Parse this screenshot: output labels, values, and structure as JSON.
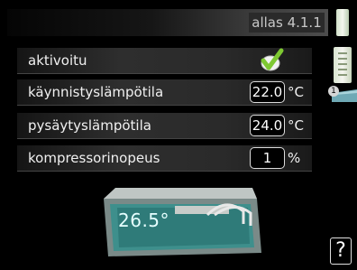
{
  "header": {
    "menu_id": "allas 4.1.1"
  },
  "rows": [
    {
      "label": "aktivoitu",
      "checked": true
    },
    {
      "label": "käynnistyslämpötila",
      "value": "22.0",
      "unit": "°C"
    },
    {
      "label": "pysäytyslämpötila",
      "value": "24.0",
      "unit": "°C"
    },
    {
      "label": "kompressorinopeus",
      "value": "1",
      "unit": "%"
    }
  ],
  "pool": {
    "temperature": "26.5°"
  },
  "side": {
    "page_badge": "1"
  },
  "help": {
    "label": "?"
  },
  "colors": {
    "checkmark": "#7ec832",
    "pool_water": "#3e8f8c",
    "scroll_green": "#d8e4cf"
  },
  "icons": [
    "checkmark-icon",
    "scroll-handle-icon",
    "pool-icon",
    "help-icon"
  ]
}
